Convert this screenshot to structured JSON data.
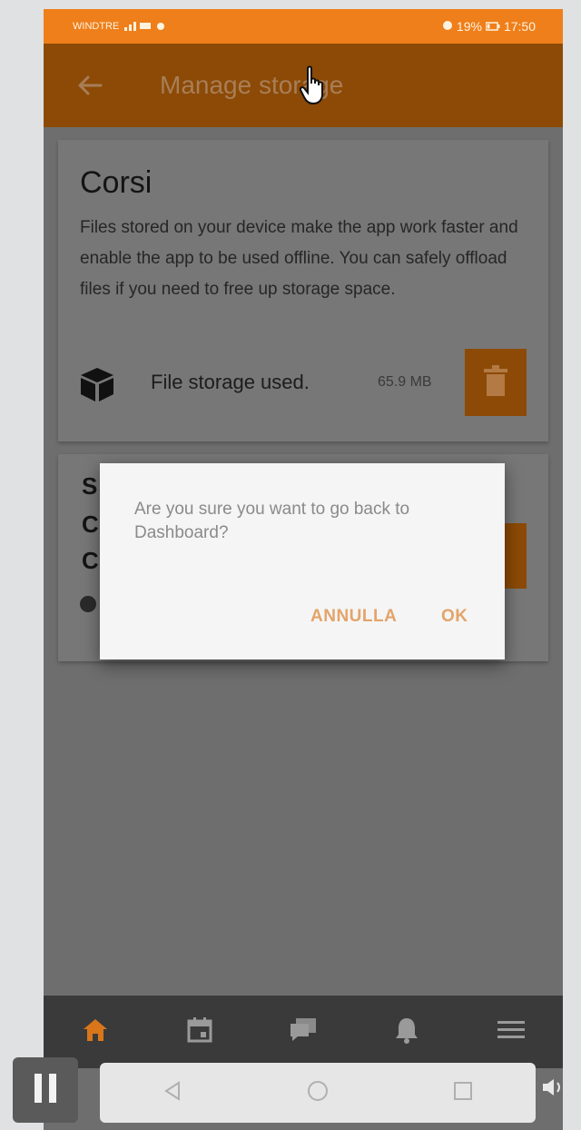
{
  "status_bar": {
    "carrier": "WINDTRE",
    "battery": "19%",
    "time": "17:50"
  },
  "app_bar": {
    "title": "Manage storage",
    "back_icon": "arrow-left-icon"
  },
  "card": {
    "title": "Corsi",
    "description": "Files stored on your device make the app work faster and enable the app to be used offline. You can safely offload files if you need to free up storage space.",
    "storage_label": "File storage used.",
    "storage_size": "65.9 MB",
    "delete_icon": "trash-icon"
  },
  "second_card": {
    "peek_lines": [
      "S",
      "C",
      "C"
    ]
  },
  "dialog": {
    "message": "Are you sure you want to go back to Dashboard?",
    "cancel_label": "ANNULLA",
    "ok_label": "OK"
  },
  "bottom_nav": {
    "items": [
      "home-icon",
      "calendar-icon",
      "messages-icon",
      "notifications-icon",
      "menu-icon"
    ],
    "active_color": "#d9761a"
  },
  "colors": {
    "accent": "#ef7f1a",
    "app_bar": "#8c4a06",
    "dialog_button": "#e3a46a"
  }
}
